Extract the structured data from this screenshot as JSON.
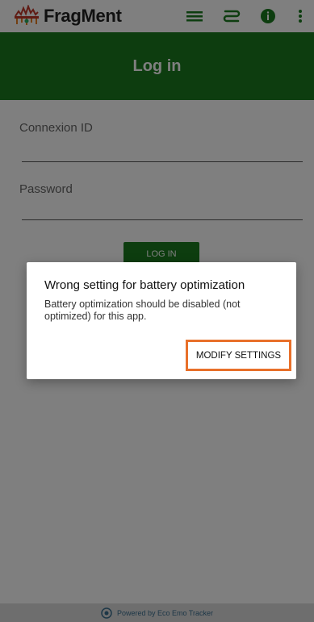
{
  "app": {
    "title": "FragMent"
  },
  "header": {
    "title": "Log in"
  },
  "form": {
    "connexion_label": "Connexion ID",
    "connexion_value": "",
    "password_label": "Password",
    "password_value": "",
    "login_button": "LOG IN"
  },
  "dialog": {
    "title": "Wrong setting for battery optimization",
    "message": "Battery optimization should be disabled (not optimized) for this app.",
    "action": "MODIFY SETTINGS"
  },
  "footer": {
    "text": "Powered by Eco Emo Tracker"
  },
  "colors": {
    "primary": "#1b7b1f",
    "highlight": "#e8702a"
  },
  "icons": [
    "fragment-logo-icon",
    "menu-icon",
    "route-icon",
    "info-icon",
    "more-vert-icon",
    "eco-emo-icon"
  ]
}
